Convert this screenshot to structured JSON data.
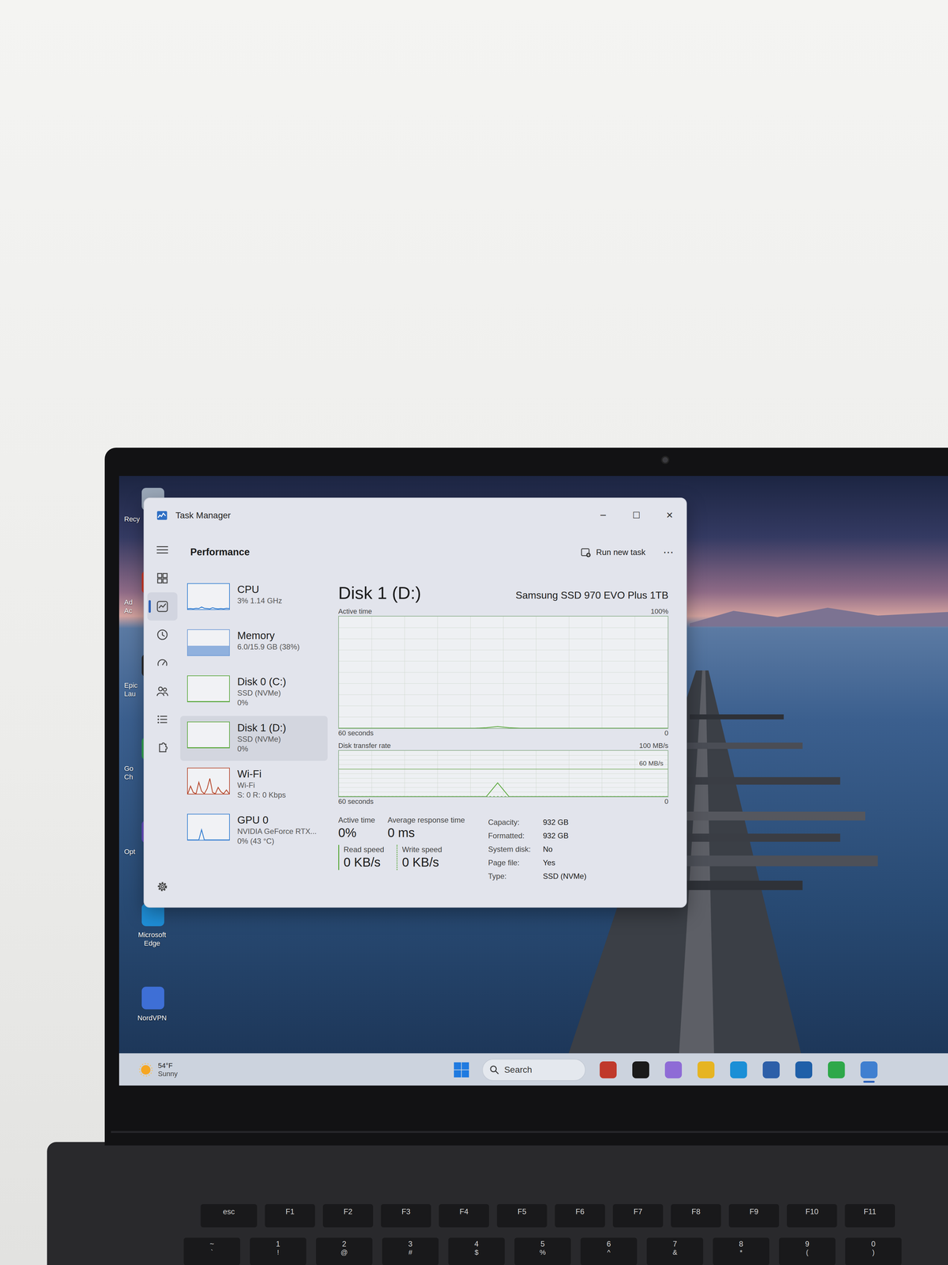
{
  "desktop": {
    "icons": [
      {
        "lines": [
          "Recy"
        ],
        "cut": true,
        "color": "#9aa7b8"
      },
      {
        "lines": [
          "Ad",
          "Ac"
        ],
        "cut": true,
        "color": "#d23a2a"
      },
      {
        "lines": [
          "Epic",
          "Lau"
        ],
        "cut": true,
        "color": "#2b2b2b"
      },
      {
        "lines": [
          "Go",
          "Ch"
        ],
        "cut": true,
        "color": "#34a853"
      },
      {
        "lines": [
          "Opt"
        ],
        "cut": true,
        "color": "#6b4fc8"
      },
      {
        "lines": [
          "Microsoft",
          "Edge"
        ],
        "cut": false,
        "color": "#1f8fd8"
      },
      {
        "lines": [
          "NordVPN"
        ],
        "cut": false,
        "color": "#3e6fd6"
      }
    ]
  },
  "window": {
    "title": "Task Manager",
    "controls": [
      "─",
      "☐",
      "✕"
    ]
  },
  "header": {
    "title": "Performance",
    "run_task": "Run new task",
    "more": "⋯"
  },
  "nav": {
    "items": [
      {
        "selected": false
      },
      {
        "selected": true
      },
      {
        "selected": false
      },
      {
        "selected": false
      },
      {
        "selected": false
      },
      {
        "selected": false
      },
      {
        "selected": false
      }
    ],
    "settings": {
      "selected": false
    }
  },
  "sidebar": {
    "items": [
      {
        "label": "CPU",
        "lines": [
          "3% 1.14 GHz"
        ],
        "selected": false,
        "kind": "line",
        "color": "#2f7bd0",
        "graph": [
          2,
          3,
          2,
          4,
          3,
          9,
          4,
          3,
          2,
          6,
          3,
          2,
          3,
          2,
          4,
          3
        ]
      },
      {
        "label": "Memory",
        "lines": [
          "6.0/15.9 GB (38%)"
        ],
        "selected": false,
        "kind": "fill",
        "color": "#6f9bd6",
        "graph": [
          38,
          38,
          38,
          38,
          38,
          38,
          38,
          38
        ]
      },
      {
        "label": "Disk 0 (C:)",
        "lines": [
          "SSD (NVMe)",
          "0%"
        ],
        "selected": false,
        "kind": "line",
        "color": "#5aa83c",
        "graph": [
          0,
          0,
          0,
          0,
          0,
          0,
          0,
          0
        ]
      },
      {
        "label": "Disk 1 (D:)",
        "lines": [
          "SSD (NVMe)",
          "0%"
        ],
        "selected": true,
        "kind": "line",
        "color": "#5aa83c",
        "graph": [
          0,
          0,
          0,
          0,
          0,
          0,
          0,
          0
        ]
      },
      {
        "label": "Wi-Fi",
        "lines": [
          "Wi-Fi",
          "S: 0 R: 0 Kbps"
        ],
        "selected": false,
        "kind": "line",
        "color": "#b5452a",
        "graph": [
          0,
          30,
          5,
          0,
          45,
          10,
          0,
          20,
          60,
          5,
          0,
          25,
          8,
          0,
          15,
          0
        ]
      },
      {
        "label": "GPU 0",
        "lines": [
          "NVIDIA GeForce RTX...",
          "0% (43 °C)"
        ],
        "selected": false,
        "kind": "line",
        "color": "#2f7bd0",
        "graph": [
          0,
          0,
          0,
          0,
          0,
          40,
          0,
          0,
          0,
          0,
          0,
          0,
          0,
          0,
          0,
          0
        ]
      }
    ]
  },
  "detail": {
    "title": "Disk 1 (D:)",
    "model": "Samsung SSD 970 EVO Plus 1TB",
    "charts": [
      {
        "label": "Active time",
        "max_label": "100%",
        "time_label": "60 seconds",
        "min_label": "0",
        "max": 100,
        "series": [
          {
            "kind": "solid",
            "color": "#5aa83c",
            "values": [
              0,
              0,
              0,
              0,
              0,
              0,
              0,
              0,
              0,
              0,
              0,
              0,
              0,
              0.4,
              1.5,
              0.4,
              0,
              0,
              0,
              0,
              0,
              0,
              0,
              0,
              0,
              0,
              0,
              0,
              0,
              0
            ]
          }
        ]
      },
      {
        "label": "Disk transfer rate",
        "max_label": "100 MB/s",
        "time_label": "60 seconds",
        "min_label": "0",
        "max": 100,
        "marker": {
          "label": "60 MB/s",
          "value": 60
        },
        "series": [
          {
            "kind": "solid",
            "color": "#5aa83c",
            "values": [
              0,
              0,
              0,
              0,
              0,
              0,
              0,
              0,
              0,
              0,
              0,
              0,
              0,
              0,
              30,
              0,
              0,
              0,
              0,
              0,
              0,
              0,
              0,
              0,
              0,
              0,
              0,
              0,
              0,
              0
            ]
          },
          {
            "kind": "dotted",
            "color": "#5aa83c",
            "values": [
              0,
              0,
              0,
              0,
              0,
              0,
              0,
              0,
              0,
              0,
              0,
              0,
              0,
              0,
              0,
              0,
              0,
              0,
              0,
              0,
              0,
              0,
              0,
              0,
              0,
              0,
              0,
              0,
              0,
              0
            ]
          }
        ]
      }
    ],
    "stats": [
      {
        "label": "Active time",
        "value": "0%"
      },
      {
        "label": "Average response time",
        "value": "0 ms"
      }
    ],
    "speeds": [
      {
        "label": "Read speed",
        "value": "0 KB/s",
        "kind": "solid"
      },
      {
        "label": "Write speed",
        "value": "0 KB/s",
        "kind": "dotted"
      }
    ],
    "properties": [
      {
        "label": "Capacity:",
        "value": "932 GB"
      },
      {
        "label": "Formatted:",
        "value": "932 GB"
      },
      {
        "label": "System disk:",
        "value": "No"
      },
      {
        "label": "Page file:",
        "value": "Yes"
      },
      {
        "label": "Type:",
        "value": "SSD (NVMe)"
      }
    ]
  },
  "taskbar": {
    "weather": {
      "temp": "54°F",
      "condition": "Sunny"
    },
    "search": "Search",
    "apps": [
      {
        "color": "#c0392b",
        "active": false
      },
      {
        "color": "#1a1a1a",
        "active": false
      },
      {
        "color": "#8e6bd6",
        "active": false
      },
      {
        "color": "#e6b422",
        "active": false
      },
      {
        "color": "#1b8fd6",
        "active": false
      },
      {
        "color": "#2d5fa8",
        "active": false
      },
      {
        "color": "#1f5fa8",
        "active": false
      },
      {
        "color": "#2ea84a",
        "active": false
      },
      {
        "color": "#3f7fd0",
        "active": true
      }
    ]
  },
  "keyboard": {
    "fn_row": [
      "esc",
      "F1",
      "F2",
      "F3",
      "F4",
      "F5",
      "F6",
      "F7",
      "F8",
      "F9",
      "F10",
      "F11"
    ],
    "number_row": [
      {
        "top": "~",
        "bottom": "`"
      },
      {
        "top": "1",
        "bottom": "!"
      },
      {
        "top": "2",
        "bottom": "@"
      },
      {
        "top": "3",
        "bottom": "#"
      },
      {
        "top": "4",
        "bottom": "$"
      },
      {
        "top": "5",
        "bottom": "%"
      },
      {
        "top": "6",
        "bottom": "^"
      },
      {
        "top": "7",
        "bottom": "&"
      },
      {
        "top": "8",
        "bottom": "*"
      },
      {
        "top": "9",
        "bottom": "("
      },
      {
        "top": "0",
        "bottom": ")"
      }
    ]
  }
}
